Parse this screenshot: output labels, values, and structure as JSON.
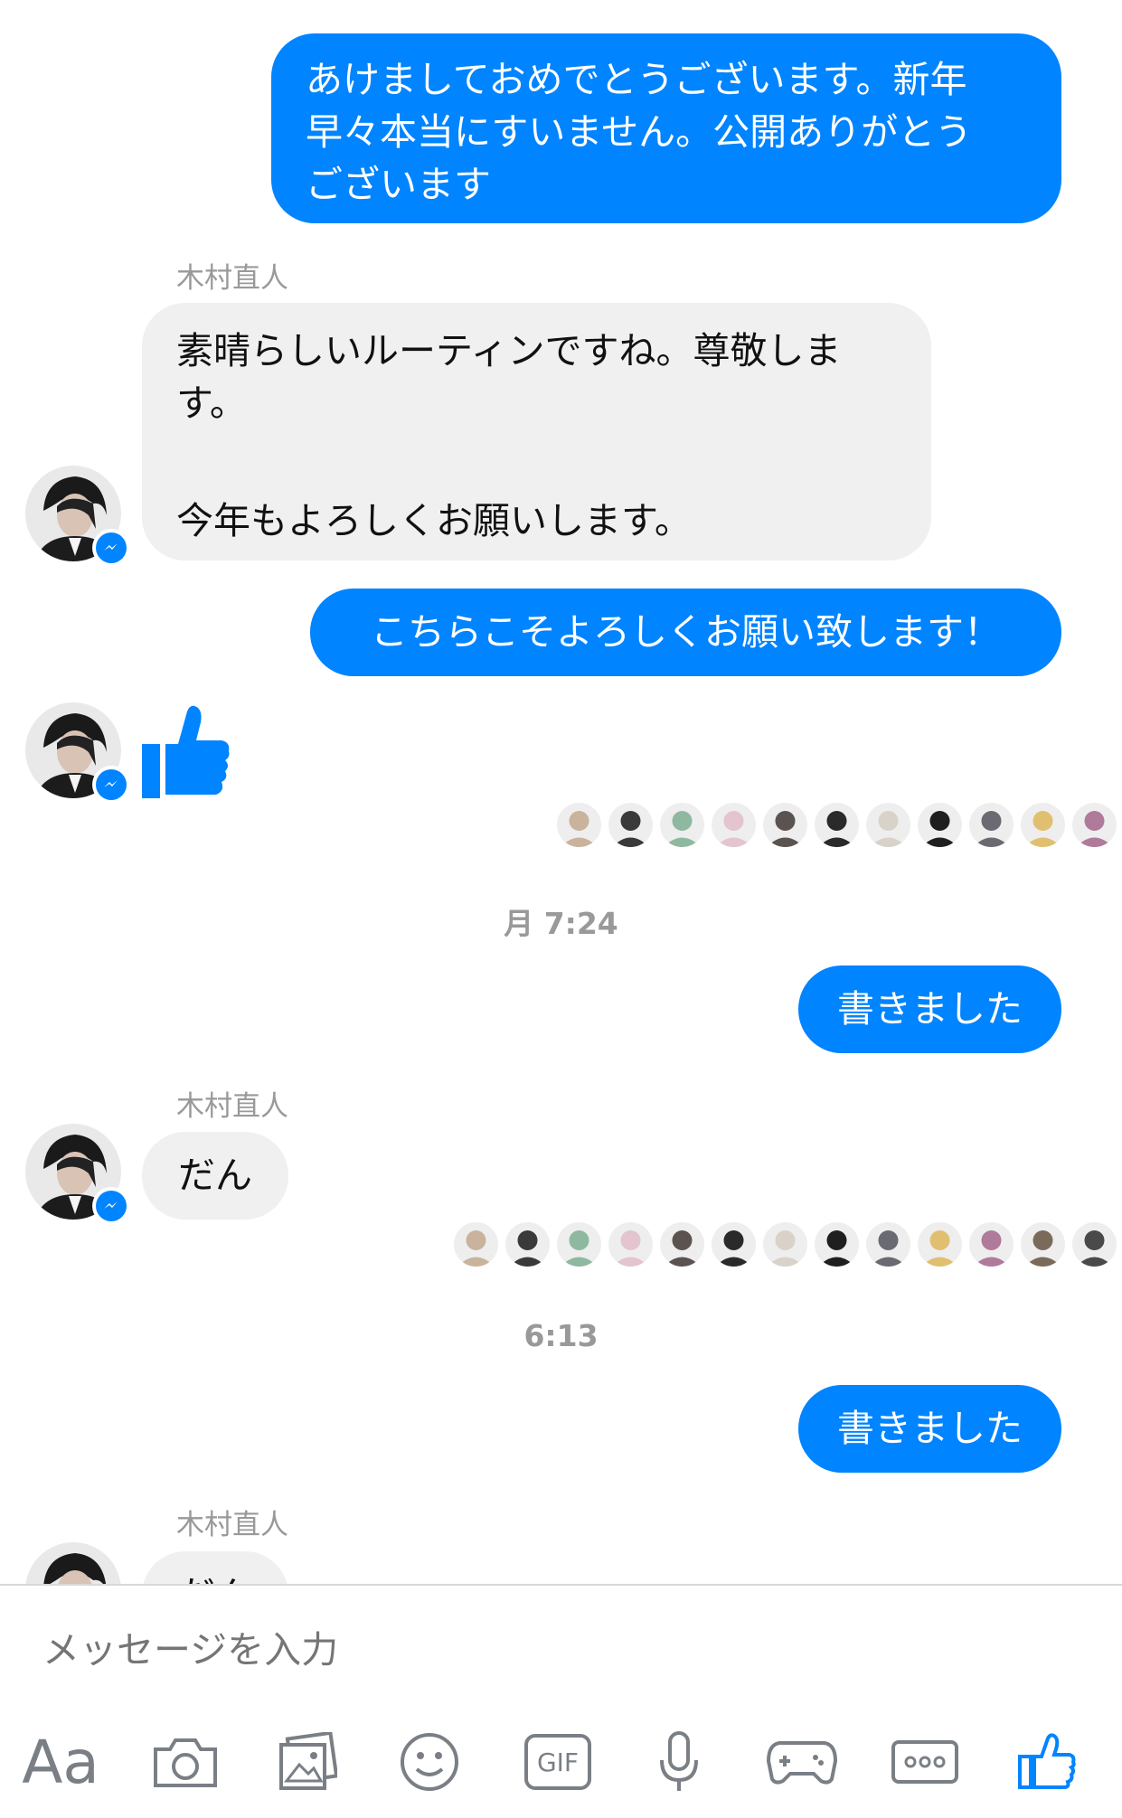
{
  "colors": {
    "accent": "#0084ff",
    "incoming_bubble": "#f1f0f0",
    "muted": "#999999"
  },
  "messages": {
    "m1": {
      "line1": "あけましておめでとうございます。新年",
      "line2": "早々本当にすいません。公開ありがとう",
      "line3": "ございます"
    },
    "sender1": "木村直人",
    "m2": {
      "line1": "素晴らしいルーティンですね。尊敬しま",
      "line2": "す。",
      "line3": "今年もよろしくお願いします。"
    },
    "m3": "こちらこそよろしくお願い致します！",
    "like_sticker": "thumbs-up-sticker",
    "timestamp1": "月 7:24",
    "m4": "書きました",
    "sender2": "木村直人",
    "m5": "だん",
    "timestamp2": "6:13",
    "m6": "書きました",
    "sender3": "木村直人",
    "m7": "だん"
  },
  "seen_by_row1_count": 11,
  "seen_by_row2_count": 13,
  "composer": {
    "placeholder": "メッセージを入力",
    "aa_label": "Aa",
    "gif_label": "GIF",
    "icons": [
      "text-format-icon",
      "camera-icon",
      "gallery-icon",
      "emoji-icon",
      "gif-icon",
      "microphone-icon",
      "game-icon",
      "more-icon",
      "like-icon"
    ]
  }
}
